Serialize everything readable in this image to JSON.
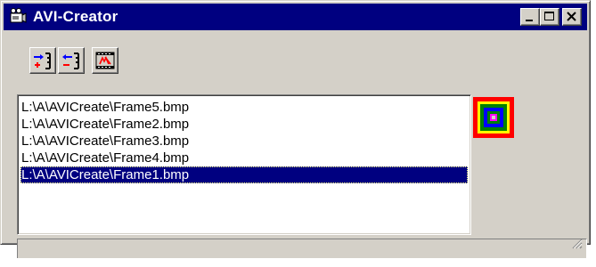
{
  "window": {
    "title": "AVI-Creator",
    "title_bar_color": "#000080",
    "face_color": "#d4d0c8",
    "icon": "app-camera-icon"
  },
  "title_buttons": [
    {
      "name": "minimize-icon"
    },
    {
      "name": "maximize-icon"
    },
    {
      "name": "close-icon"
    }
  ],
  "toolbar": {
    "buttons": [
      {
        "icon": "add-frame-icon"
      },
      {
        "icon": "remove-frame-icon"
      },
      {
        "icon": "create-avi-film-icon"
      }
    ]
  },
  "frame_list": {
    "items": [
      "L:\\A\\AVICreate\\Frame5.bmp",
      "L:\\A\\AVICreate\\Frame2.bmp",
      "L:\\A\\AVICreate\\Frame3.bmp",
      "L:\\A\\AVICreate\\Frame4.bmp",
      "L:\\A\\AVICreate\\Frame1.bmp"
    ],
    "selected_index": 4,
    "selection_color": "#000080"
  },
  "preview": {
    "icon": "frame-preview-icon",
    "colors": [
      "#ff0000",
      "#ffff00",
      "#008000",
      "#0000ff",
      "#ff00ff"
    ]
  },
  "statusbar": {
    "text": "",
    "grip_icon": "resize-grip-icon"
  }
}
